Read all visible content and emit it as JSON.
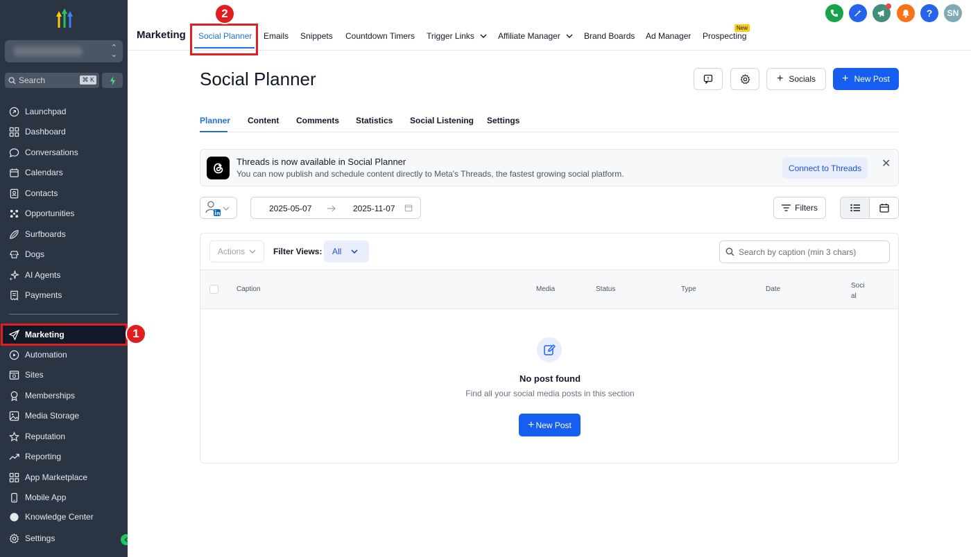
{
  "sidebar": {
    "search_placeholder": "Search",
    "search_shortcut": "⌘ K",
    "items": [
      {
        "label": "Launchpad"
      },
      {
        "label": "Dashboard"
      },
      {
        "label": "Conversations"
      },
      {
        "label": "Calendars"
      },
      {
        "label": "Contacts"
      },
      {
        "label": "Opportunities"
      },
      {
        "label": "Surfboards"
      },
      {
        "label": "Dogs"
      },
      {
        "label": "AI Agents"
      },
      {
        "label": "Payments"
      },
      {
        "label": "Marketing"
      },
      {
        "label": "Automation"
      },
      {
        "label": "Sites"
      },
      {
        "label": "Memberships"
      },
      {
        "label": "Media Storage"
      },
      {
        "label": "Reputation"
      },
      {
        "label": "Reporting"
      },
      {
        "label": "App Marketplace"
      },
      {
        "label": "Mobile App"
      },
      {
        "label": "Knowledge Center"
      }
    ],
    "settings_label": "Settings",
    "active_color": "#111827"
  },
  "annotations": {
    "step1": "1",
    "step2": "2",
    "color": "#e11d1d"
  },
  "topnav": {
    "title": "Marketing",
    "tabs": [
      {
        "label": "Social Planner"
      },
      {
        "label": "Emails"
      },
      {
        "label": "Snippets"
      },
      {
        "label": "Countdown Timers"
      },
      {
        "label": "Trigger Links"
      },
      {
        "label": "Affiliate Manager"
      },
      {
        "label": "Brand Boards"
      },
      {
        "label": "Ad Manager"
      },
      {
        "label": "Prospecting"
      }
    ],
    "new_badge": "New",
    "avatar_initials": "SN",
    "help_label": "?"
  },
  "page": {
    "title": "Social Planner",
    "socials_label": "Socials",
    "new_post_label": "New Post",
    "subtabs": [
      {
        "label": "Planner"
      },
      {
        "label": "Content"
      },
      {
        "label": "Comments"
      },
      {
        "label": "Statistics"
      },
      {
        "label": "Social Listening"
      },
      {
        "label": "Settings"
      }
    ]
  },
  "banner": {
    "title": "Threads is now available in Social Planner",
    "subtitle": "You can now publish and schedule content directly to Meta's Threads, the fastest growing social platform.",
    "connect_label": "Connect to Threads",
    "close": "✕"
  },
  "filters": {
    "start_date": "2025-05-07",
    "end_date": "2025-11-07",
    "filters_label": "Filters"
  },
  "table": {
    "actions_label": "Actions",
    "filter_views_label": "Filter Views:",
    "filter_views_value": "All",
    "search_placeholder": "Search by caption (min 3 chars)",
    "columns": [
      "Caption",
      "Media",
      "Status",
      "Type",
      "Date",
      "Soci",
      "al"
    ],
    "empty_title": "No post found",
    "empty_subtitle": "Find all your social media posts in this section",
    "empty_button": "New Post"
  },
  "colors": {
    "primary": "#155eef",
    "accent": "#1d72d8",
    "sidebar": "#2b3442"
  }
}
